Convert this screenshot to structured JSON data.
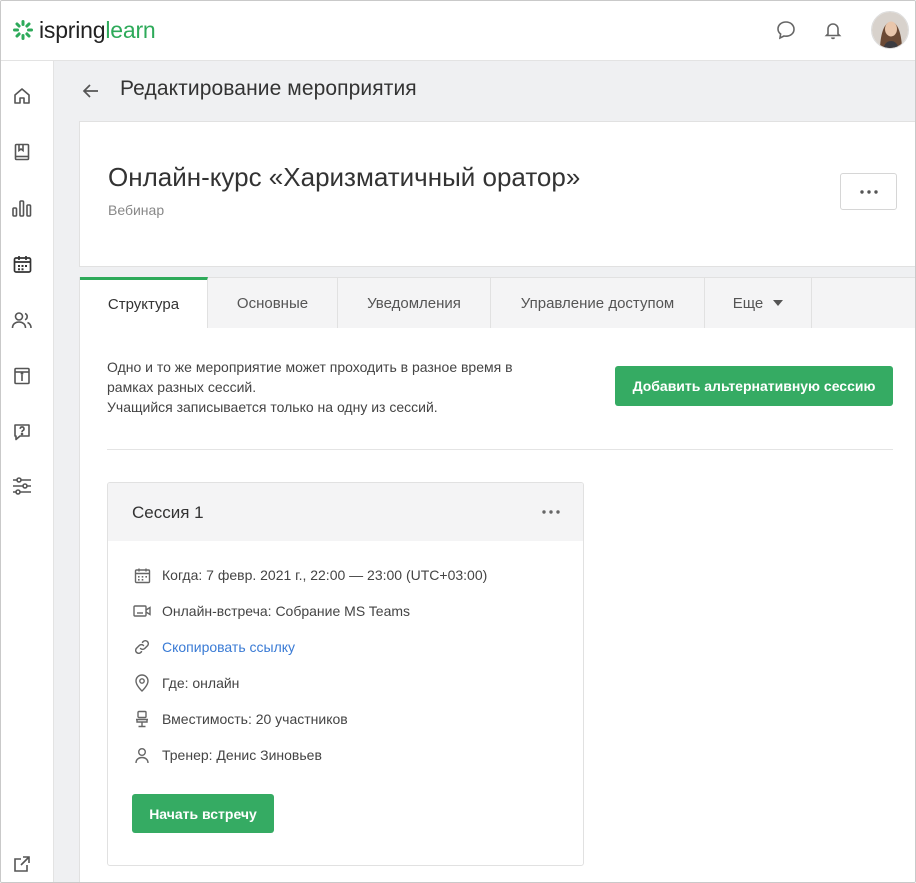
{
  "brand": {
    "name_part1": "ispring",
    "name_part2": "learn",
    "accent": "#2eaa5a"
  },
  "header": {
    "icons": [
      "chat-icon",
      "bell-icon"
    ],
    "avatar": "user-avatar"
  },
  "sidebar": {
    "items": [
      {
        "icon": "home-icon"
      },
      {
        "icon": "book-icon"
      },
      {
        "icon": "chart-icon"
      },
      {
        "icon": "calendar-icon"
      },
      {
        "icon": "users-icon"
      },
      {
        "icon": "info-icon"
      },
      {
        "icon": "question-icon"
      },
      {
        "icon": "settings-sliders-icon"
      }
    ],
    "bottom_icon": "external-link-icon"
  },
  "page": {
    "title": "Редактирование мероприятия"
  },
  "event": {
    "title": "Онлайн-курс «Харизматичный оратор»",
    "type": "Вебинар"
  },
  "tabs": [
    {
      "label": "Структура",
      "active": true
    },
    {
      "label": "Основные"
    },
    {
      "label": "Уведомления"
    },
    {
      "label": "Управление доступом"
    },
    {
      "label": "Еще"
    }
  ],
  "intro": {
    "line1": "Одно и то же мероприятие может проходить в разное время в",
    "line2": "рамках разных сессий.",
    "line3": "Учащийся записывается только на одну из сессий."
  },
  "add_session_label": "Добавить альтернативную сессию",
  "session": {
    "title": "Сессия 1",
    "when": "Когда: 7 февр. 2021 г., 22:00 — 23:00 (UTC+03:00)",
    "meeting": "Онлайн-встреча: Собрание MS Teams",
    "copy_link": "Скопировать ссылку",
    "where": "Где: онлайн",
    "capacity": "Вместимость: 20 участников",
    "trainer": "Тренер: Денис Зиновьев",
    "start_label": "Начать встречу"
  }
}
